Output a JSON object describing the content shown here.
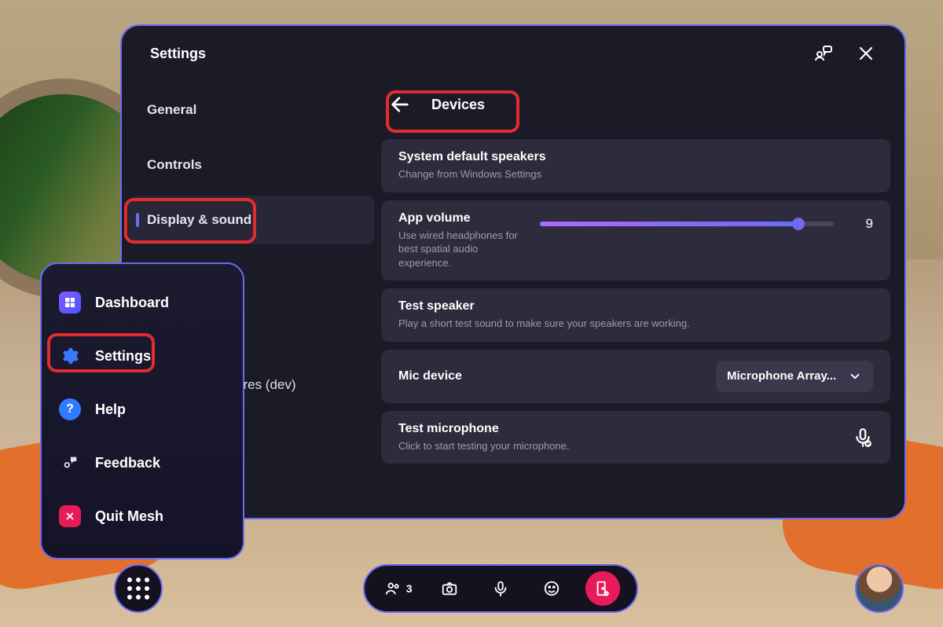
{
  "header": {
    "title": "Settings"
  },
  "sidebar": {
    "items": [
      {
        "label": "General"
      },
      {
        "label": "Controls"
      },
      {
        "label": "Display & sound"
      }
    ],
    "partial_item_label": "ures (dev)"
  },
  "content": {
    "title": "Devices",
    "speakers": {
      "title": "System default speakers",
      "sub": "Change from Windows Settings"
    },
    "volume": {
      "title": "App volume",
      "sub": "Use wired headphones for best spatial audio experience.",
      "value": 9,
      "max": 10,
      "value_text": "9"
    },
    "test_speaker": {
      "title": "Test speaker",
      "sub": "Play a short test sound to make sure your speakers are working."
    },
    "mic_device": {
      "title": "Mic device",
      "selected": "Microphone Array..."
    },
    "test_mic": {
      "title": "Test microphone",
      "sub": "Click to start testing your microphone."
    }
  },
  "menu": {
    "items": [
      {
        "label": "Dashboard"
      },
      {
        "label": "Settings"
      },
      {
        "label": "Help"
      },
      {
        "label": "Feedback"
      },
      {
        "label": "Quit Mesh"
      }
    ]
  },
  "toolbar": {
    "people_count": "3"
  }
}
